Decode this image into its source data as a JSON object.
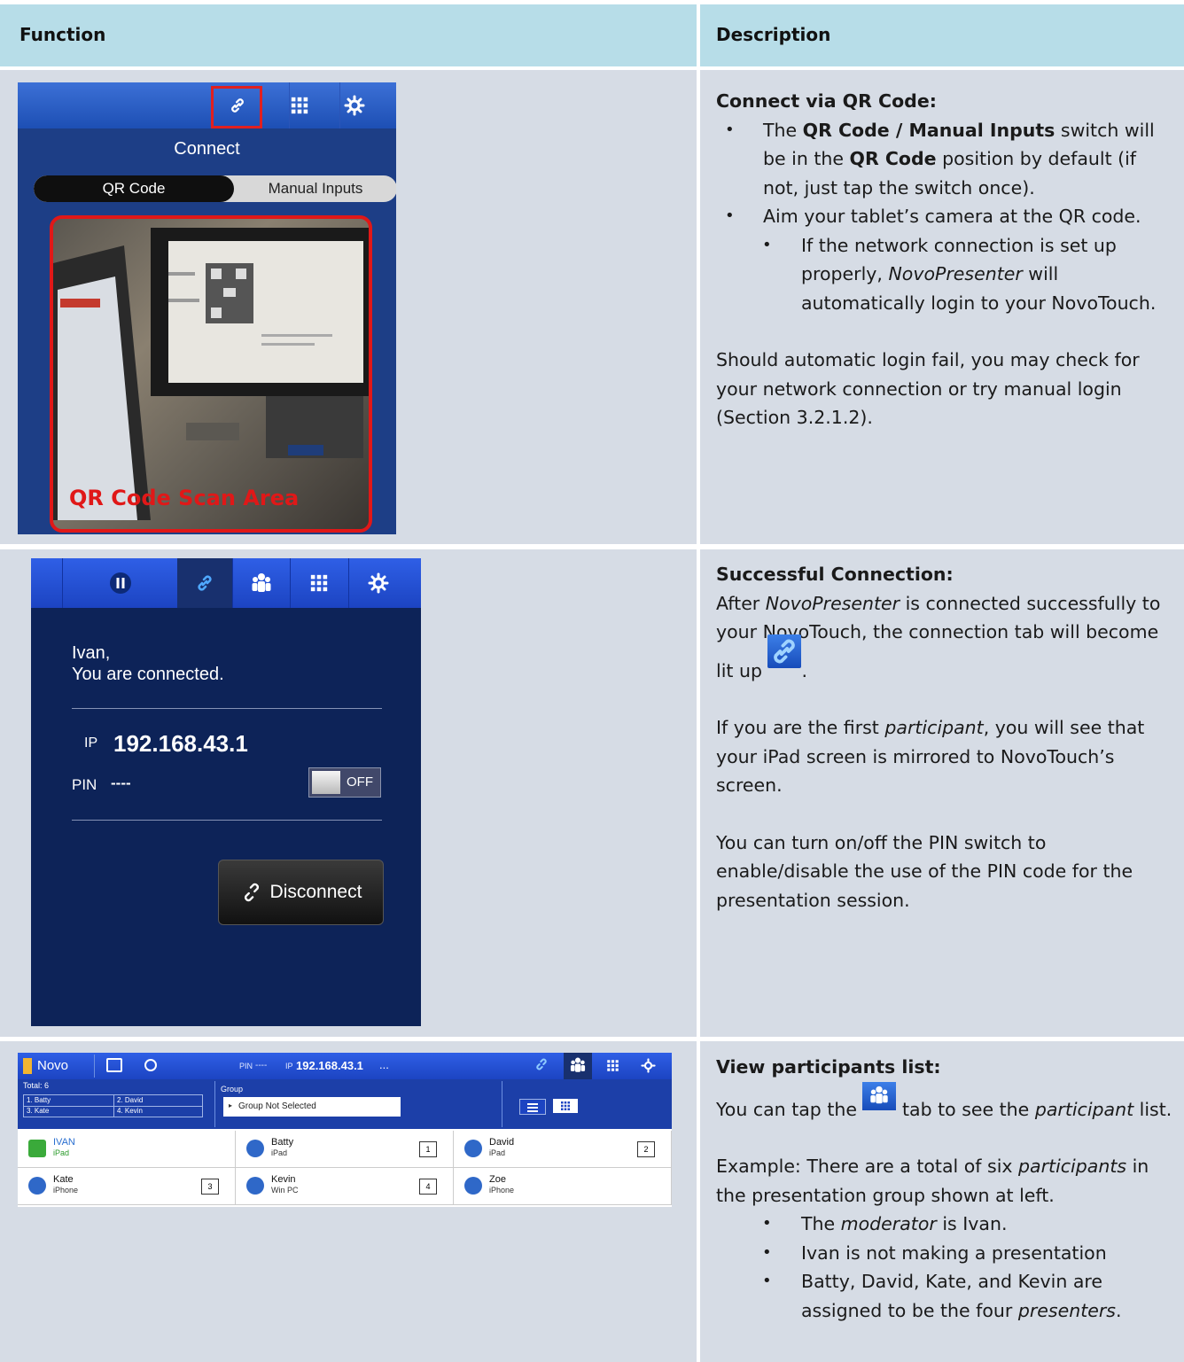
{
  "header": {
    "function_label": "Function",
    "description_label": "Description"
  },
  "colors": {
    "header_bg": "#b7dde8",
    "row_bg": "#d6dce5",
    "accent_red": "#e01818",
    "app_blue": "#1c44c2"
  },
  "row1": {
    "screenshot": {
      "toolbar_icons": [
        "link-icon",
        "apps-grid-icon",
        "gear-icon"
      ],
      "title": "Connect",
      "segment_on": "QR Code",
      "segment_off": "Manual Inputs",
      "scan_label": "QR Code Scan Area"
    },
    "desc": {
      "heading": "Connect via QR Code:",
      "b1_a": "The ",
      "b1_b": "QR Code / Manual Inputs",
      "b1_c": " switch will be in the ",
      "b1_d": "QR Code",
      "b1_e": " position by default (if not, just tap the switch once).",
      "b2": "Aim your tablet’s camera at the QR code.",
      "b3_a": "If the network connection is set up properly, ",
      "b3_b": "NovoPresenter",
      "b3_c": " will automatically login to your NovoTouch.",
      "para": "Should automatic login fail, you may check for your network connection or try manual login (Section 3.2.1.2)."
    }
  },
  "row2": {
    "screenshot": {
      "toolbar_icons": [
        "pause-icon",
        "link-icon",
        "participants-icon",
        "apps-grid-icon",
        "gear-icon"
      ],
      "greeting_name": "Ivan,",
      "greeting_text": "You are connected.",
      "ip_label": "IP",
      "ip_value": "192.168.43.1",
      "pin_label": "PIN",
      "pin_value": "----",
      "pin_toggle": "OFF",
      "disconnect_label": "Disconnect"
    },
    "desc": {
      "heading": "Successful Connection:",
      "p1_a": "After ",
      "p1_b": "NovoPresenter",
      "p1_c": " is connected successfully to your NovoTouch, the connection tab will become lit up ",
      "p1_d": ".",
      "p2_a": "If you are the first ",
      "p2_b": "participant",
      "p2_c": ", you will see that your iPad screen is mirrored to NovoTouch’s screen.",
      "p3": "You can turn on/off the PIN switch to enable/disable the use of the PIN code for the presentation session."
    }
  },
  "row3": {
    "screenshot": {
      "app_name": "Novo",
      "pin_label": "PIN",
      "pin_value": "----",
      "ip_label": "IP",
      "ip_value": "192.168.43.1",
      "more": "...",
      "total_label": "Total: 6",
      "presenter_slots": [
        "1. Batty",
        "2. David",
        "3. Kate",
        "4. Kevin"
      ],
      "group_label": "Group",
      "group_value": "Group Not Selected",
      "participants": [
        {
          "name": "IVAN",
          "device": "iPad",
          "slot": ""
        },
        {
          "name": "Batty",
          "device": "iPad",
          "slot": "1"
        },
        {
          "name": "David",
          "device": "iPad",
          "slot": "2"
        },
        {
          "name": "Kate",
          "device": "iPhone",
          "slot": "3"
        },
        {
          "name": "Kevin",
          "device": "Win PC",
          "slot": "4"
        },
        {
          "name": "Zoe",
          "device": "iPhone",
          "slot": ""
        }
      ]
    },
    "desc": {
      "heading": "View participants list:",
      "p1_a": "You can tap the ",
      "p1_b": " tab to see the ",
      "p1_c": "participant",
      "p1_d": " list.",
      "p2_a": "Example: There are a total of six ",
      "p2_b": "participants",
      "p2_c": " in the presentation group shown at left.",
      "b1_a": "The ",
      "b1_b": "moderator",
      "b1_c": " is Ivan.",
      "b2": "Ivan is not making a presentation",
      "b3_a": "Batty, David, Kate, and Kevin are assigned to be the four ",
      "b3_b": "presenters",
      "b3_c": "."
    }
  }
}
